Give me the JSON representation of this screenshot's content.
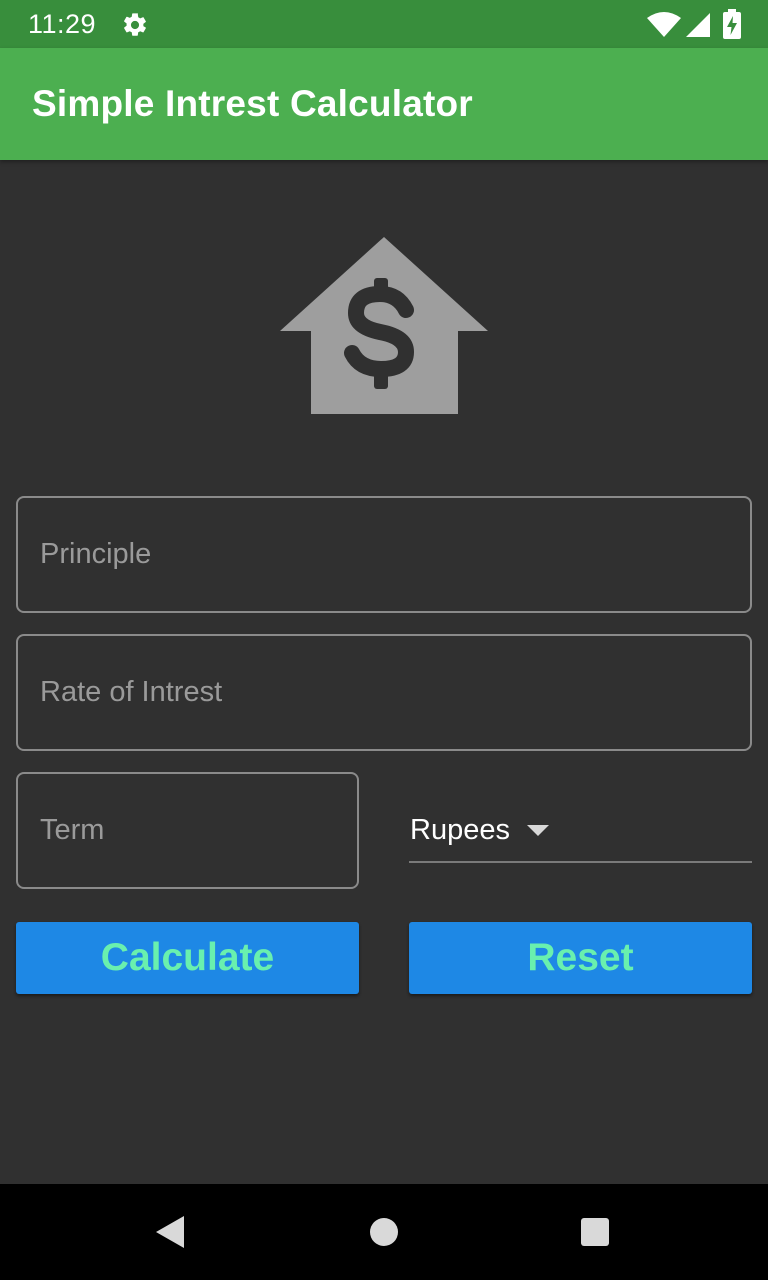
{
  "status_bar": {
    "time": "11:29",
    "icons": [
      "gear-icon",
      "wifi-icon",
      "cell-signal-icon",
      "battery-charging-icon"
    ]
  },
  "app_bar": {
    "title": "Simple Intrest Calculator",
    "color": "#4caf50"
  },
  "hero": {
    "icon": "house-dollar-icon"
  },
  "form": {
    "principle": {
      "value": "",
      "placeholder": "Principle"
    },
    "rate": {
      "value": "",
      "placeholder": "Rate of Intrest"
    },
    "term": {
      "value": "",
      "placeholder": "Term"
    },
    "currency": {
      "selected": "Rupees"
    }
  },
  "buttons": {
    "calculate_label": "Calculate",
    "reset_label": "Reset",
    "background": "#1e88e5",
    "text_color": "#69f0ae"
  },
  "nav_bar": {
    "icons": [
      "back-icon",
      "home-icon",
      "recent-apps-icon"
    ]
  }
}
